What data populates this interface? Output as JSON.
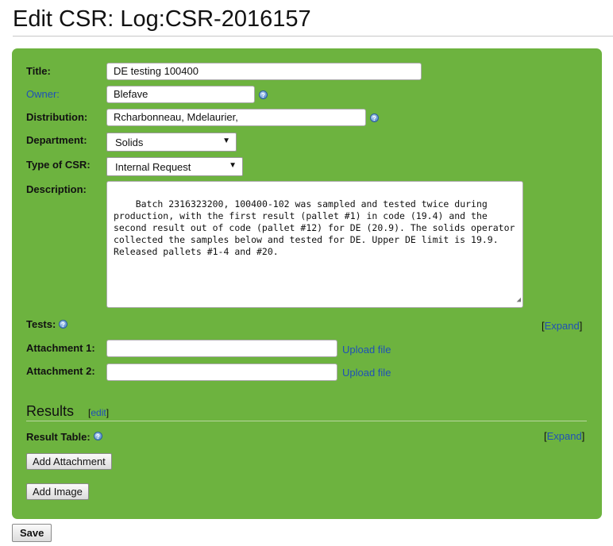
{
  "page": {
    "title": "Edit CSR: Log:CSR-2016157"
  },
  "form": {
    "title_label": "Title:",
    "title_value": "DE testing 100400",
    "owner_label": "Owner:",
    "owner_value": "Blefave",
    "distribution_label": "Distribution:",
    "distribution_value": "Rcharbonneau, Mdelaurier,",
    "department_label": "Department:",
    "department_value": "Solids",
    "type_label": "Type of CSR:",
    "type_value": "Internal Request",
    "description_label": "Description:",
    "description_value": "Batch 2316323200, 100400-102 was sampled and tested twice during production, with the first result (pallet #1) in code (19.4) and the second result out of code (pallet #12) for DE (20.9). The solids operator collected the samples below and tested for DE. Upper DE limit is 19.9. Released pallets #1-4 and #20.",
    "tests_label": "Tests:",
    "expand_label": "Expand",
    "attachment1_label": "Attachment 1:",
    "attachment2_label": "Attachment 2:",
    "upload_label": "Upload file"
  },
  "results": {
    "heading": "Results",
    "edit_label": "edit",
    "result_table_label": "Result Table:",
    "expand_label": "Expand",
    "add_attachment_label": "Add Attachment",
    "add_image_label": "Add Image"
  },
  "footer": {
    "save_label": "Save"
  },
  "icons": {
    "help": "help-icon",
    "dropdown": "dropdown-caret-icon",
    "resize": "resize-grip-icon"
  },
  "colors": {
    "panel": "#6db33f",
    "link": "#1f50b8"
  }
}
